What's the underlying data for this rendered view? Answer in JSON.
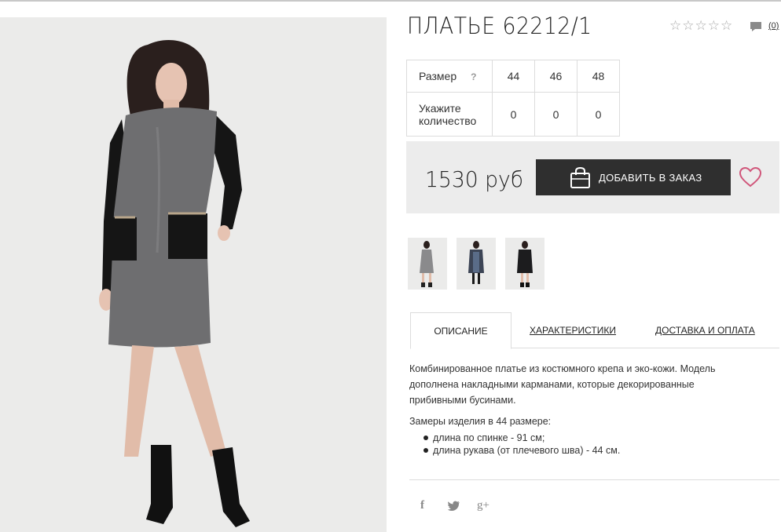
{
  "product": {
    "title": "ПЛАТЬЕ 62212/1",
    "rating_stars": 0,
    "rating_max": 5,
    "comments_count": "(0)",
    "price": "1530 руб",
    "order_button": "ДОБАВИТЬ В ЗАКАЗ"
  },
  "size_table": {
    "size_label": "Размер",
    "help_mark": "?",
    "qty_label": "Укажите количество",
    "sizes": [
      "44",
      "46",
      "48"
    ],
    "quantities": [
      "0",
      "0",
      "0"
    ]
  },
  "tabs": [
    "ОПИСАНИЕ",
    "ХАРАКТЕРИСТИКИ",
    "ДОСТАВКА И ОПЛАТА"
  ],
  "description": {
    "text": "Комбинированное платье из костюмного крепа и эко-кожи. Модель дополнена накладными карманами, которые декорированные прибивными бусинами.",
    "measure_title": "Замеры изделия в 44 размере:",
    "measures": [
      "длина по спинке - 91 см;",
      "длина рукава (от плечевого шва) - 44 см."
    ]
  },
  "social": {
    "facebook": "f",
    "twitter": "t",
    "gplus": "g+"
  },
  "icons": {
    "star": "star-outline-icon",
    "comment": "comment-icon",
    "bag": "shopping-bag-icon",
    "heart": "heart-icon"
  },
  "colors": {
    "button_bg": "#2f2f2f",
    "heart": "#d0567a",
    "buy_box_bg": "#ececec",
    "dress": "#6e6e70"
  }
}
